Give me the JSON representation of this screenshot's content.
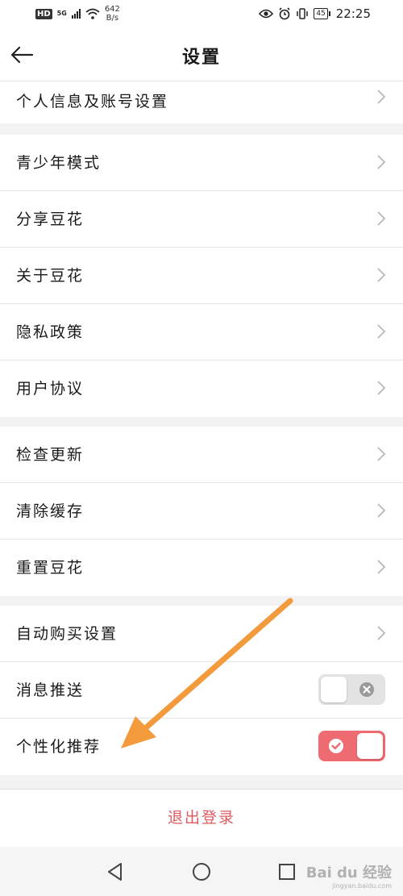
{
  "status_bar": {
    "hd": "HD",
    "network": "5G",
    "speed_value": "642",
    "speed_unit": "B/s",
    "battery": "45",
    "time": "22:25"
  },
  "header": {
    "title": "设置",
    "back_icon": "arrow-left-icon"
  },
  "settings": {
    "account": "个人信息及账号设置",
    "youth_mode": "青少年模式",
    "share": "分享豆花",
    "about": "关于豆花",
    "privacy": "隐私政策",
    "agreement": "用户协议",
    "check_update": "检查更新",
    "clear_cache": "清除缓存",
    "reset": "重置豆花",
    "auto_buy": "自动购买设置",
    "push": {
      "label": "消息推送",
      "enabled": false
    },
    "personalized": {
      "label": "个性化推荐",
      "enabled": true
    }
  },
  "logout_label": "退出登录",
  "watermark": {
    "brand": "Bai du 经验",
    "url": "jingyan.baidu.com"
  },
  "colors": {
    "accent": "#ef6b72",
    "logout": "#e05a5f",
    "annotation_arrow": "#f39a3d"
  }
}
